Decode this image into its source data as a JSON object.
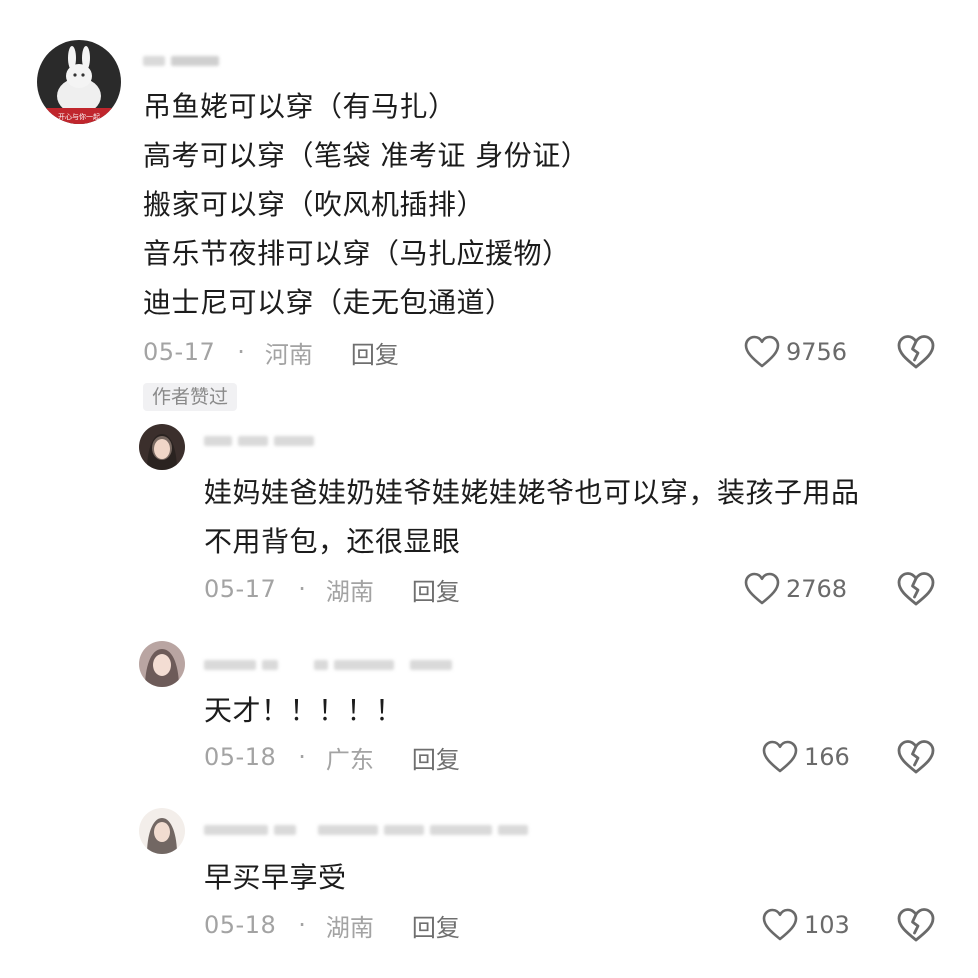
{
  "comments": [
    {
      "avatar_caption": "开心与你一起",
      "body_lines": [
        "吊鱼姥可以穿（有马扎）",
        "高考可以穿（笔袋  准考证  身份证）",
        "搬家可以穿（吹风机插排）",
        "音乐节夜排可以穿（马扎应援物）",
        "迪士尼可以穿（走无包通道）"
      ],
      "date": "05-17",
      "dot": "·",
      "location": "河南",
      "reply_label": "回复",
      "likes": "9756",
      "author_badge": "作者赞过"
    },
    {
      "body_lines": [
        "娃妈娃爸娃奶娃爷娃姥娃姥爷也可以穿，装孩子用品",
        "不用背包，还很显眼"
      ],
      "date": "05-17",
      "dot": "·",
      "location": "湖南",
      "reply_label": "回复",
      "likes": "2768"
    },
    {
      "body_lines": [
        "天才！！！！！"
      ],
      "date": "05-18",
      "dot": "·",
      "location": "广东",
      "reply_label": "回复",
      "likes": "166"
    },
    {
      "body_lines": [
        "早买早享受"
      ],
      "date": "05-18",
      "dot": "·",
      "location": "湖南",
      "reply_label": "回复",
      "likes": "103"
    }
  ],
  "icons": {
    "like": "heart-outline-icon",
    "dislike": "broken-heart-icon"
  },
  "colors": {
    "meta_text": "#a3a3a3",
    "reply_text": "#6f6f6f",
    "icon_stroke": "#6a6a6a",
    "badge_bg": "#f1f1f3"
  }
}
